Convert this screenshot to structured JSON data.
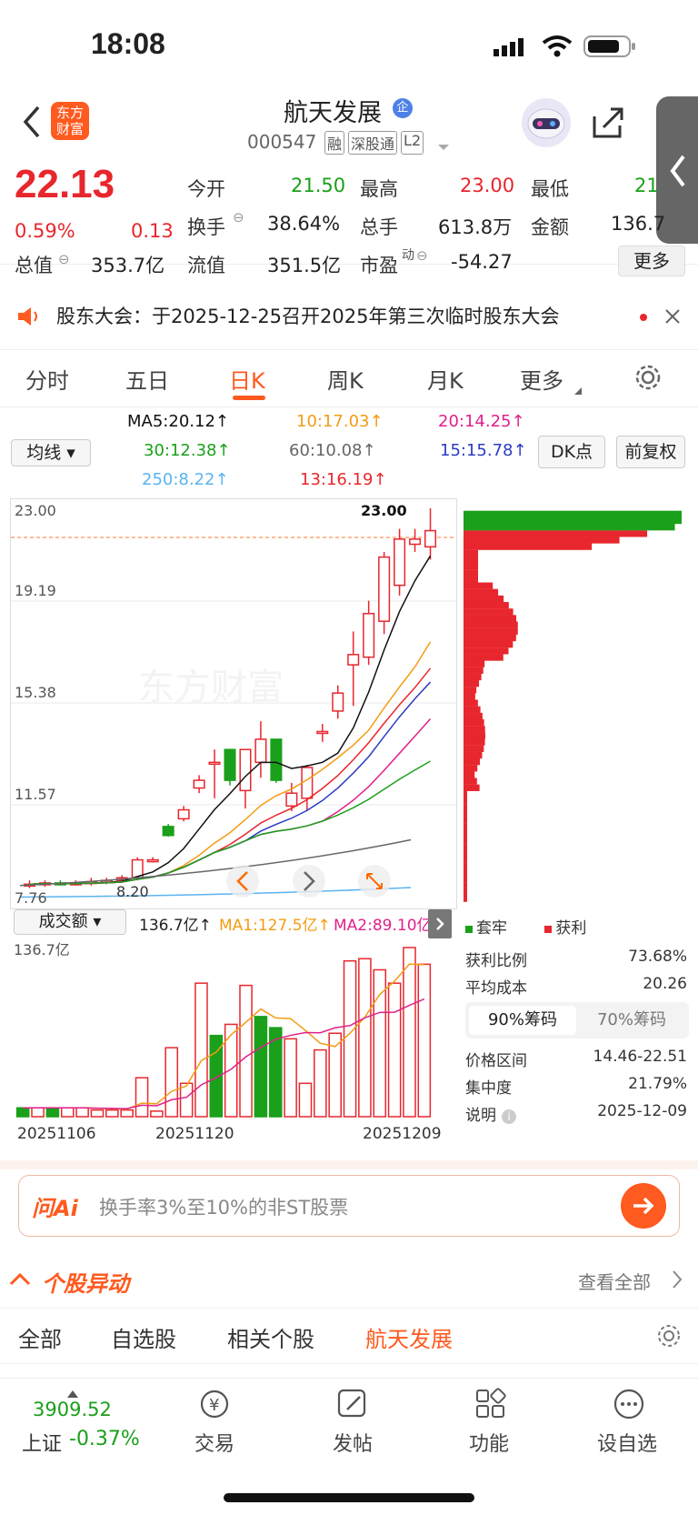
{
  "status": {
    "time": "18:08"
  },
  "header": {
    "logo_text": "东方财富",
    "stock_name": "航天发展",
    "stock_code": "000547",
    "tags": [
      "融",
      "深股通",
      "L2"
    ]
  },
  "quote": {
    "price": "22.13",
    "change_pct": "0.59%",
    "change": "0.13",
    "total_value_label": "总值",
    "total_value": "353.7亿",
    "float_value_label": "流值",
    "float_value": "351.5亿",
    "open_label": "今开",
    "open": "21.50",
    "high_label": "最高",
    "high": "23.00",
    "low_label": "最低",
    "low": "21",
    "turnover_label": "换手",
    "turnover": "38.64%",
    "volume_label": "总手",
    "volume": "613.8万",
    "amount_label": "金额",
    "amount": "136.7",
    "pe_label": "市盈",
    "pe_sup": "动",
    "pe": "-54.27",
    "more_button": "更多"
  },
  "notice": {
    "text": "股东大会：于2025-12-25召开2025年第三次临时股东大会"
  },
  "tabs": [
    {
      "label": "分时"
    },
    {
      "label": "五日"
    },
    {
      "label": "日K"
    },
    {
      "label": "周K"
    },
    {
      "label": "月K"
    },
    {
      "label": "更多"
    }
  ],
  "ma": {
    "selector": "均线",
    "ma5": "MA5:20.12↑",
    "ma10": "10:17.03↑",
    "ma20": "20:14.25↑",
    "ma30": "30:12.38↑",
    "ma60": "60:10.08↑",
    "ma15": "15:15.78↑",
    "ma250": "250:8.22↑",
    "ma13": "13:16.19↑",
    "dk_button": "DK点",
    "adjust_button": "前复权"
  },
  "chart_data": {
    "type": "candlestick",
    "y_ticks": [
      "23.00",
      "19.19",
      "15.38",
      "11.57",
      "7.76"
    ],
    "high_marker": "23.00",
    "low_marker": "8.20",
    "volume_panel": {
      "selector": "成交额",
      "current": "136.7亿↑",
      "ma1": "MA1:127.5亿↑",
      "ma2": "MA2:89.10亿",
      "max_label": "136.7亿",
      "x_labels": [
        "20251106",
        "20251120",
        "20251209"
      ],
      "volume_values": [
        8,
        8,
        8,
        8,
        8,
        6,
        6,
        6,
        35,
        5,
        62,
        30,
        120,
        73,
        83,
        118,
        90,
        80,
        70,
        30,
        60,
        75,
        140,
        142,
        132,
        120,
        152,
        137
      ],
      "volume_up": [
        false,
        true,
        false,
        true,
        true,
        true,
        true,
        true,
        true,
        true,
        true,
        true,
        true,
        false,
        true,
        true,
        false,
        false,
        true,
        true,
        true,
        true,
        true,
        true,
        true,
        true,
        true,
        true
      ]
    },
    "candles": [
      {
        "o": 8.3,
        "c": 8.35,
        "h": 8.5,
        "l": 8.2
      },
      {
        "o": 8.35,
        "c": 8.4,
        "h": 8.5,
        "l": 8.25
      },
      {
        "o": 8.4,
        "c": 8.35,
        "h": 8.5,
        "l": 8.3
      },
      {
        "o": 8.35,
        "c": 8.4,
        "h": 8.5,
        "l": 8.3
      },
      {
        "o": 8.4,
        "c": 8.45,
        "h": 8.6,
        "l": 8.3
      },
      {
        "o": 8.45,
        "c": 8.5,
        "h": 8.6,
        "l": 8.35
      },
      {
        "o": 8.5,
        "c": 8.6,
        "h": 8.7,
        "l": 8.4
      },
      {
        "o": 8.6,
        "c": 9.3,
        "h": 9.4,
        "l": 8.5
      },
      {
        "o": 9.3,
        "c": 9.3,
        "h": 9.4,
        "l": 9.2
      },
      {
        "o": 10.6,
        "c": 10.25,
        "h": 10.7,
        "l": 10.2
      },
      {
        "o": 10.9,
        "c": 11.25,
        "h": 11.4,
        "l": 10.8
      },
      {
        "o": 12.1,
        "c": 12.4,
        "h": 12.6,
        "l": 11.9
      },
      {
        "o": 13.1,
        "c": 13.1,
        "h": 13.6,
        "l": 11.7
      },
      {
        "o": 13.6,
        "c": 12.4,
        "h": 13.6,
        "l": 12.2
      },
      {
        "o": 12.0,
        "c": 13.6,
        "h": 13.6,
        "l": 11.3
      },
      {
        "o": 13.1,
        "c": 14.0,
        "h": 14.7,
        "l": 12.5
      },
      {
        "o": 14.0,
        "c": 12.4,
        "h": 14.0,
        "l": 12.3
      },
      {
        "o": 11.4,
        "c": 11.9,
        "h": 12.3,
        "l": 11.2
      },
      {
        "o": 11.7,
        "c": 12.9,
        "h": 13.0,
        "l": 11.2
      },
      {
        "o": 14.3,
        "c": 14.3,
        "h": 14.6,
        "l": 13.9
      },
      {
        "o": 15.1,
        "c": 15.8,
        "h": 16.1,
        "l": 14.8
      },
      {
        "o": 16.9,
        "c": 17.3,
        "h": 18.2,
        "l": 15.3
      },
      {
        "o": 17.2,
        "c": 18.9,
        "h": 19.4,
        "l": 16.9
      },
      {
        "o": 18.6,
        "c": 21.1,
        "h": 21.3,
        "l": 18.1
      },
      {
        "o": 20.0,
        "c": 21.8,
        "h": 22.2,
        "l": 19.6
      },
      {
        "o": 21.6,
        "c": 21.8,
        "h": 22.2,
        "l": 21.3
      },
      {
        "o": 21.5,
        "c": 22.13,
        "h": 23.0,
        "l": 21.0
      }
    ],
    "ylim": [
      7.76,
      23.0
    ]
  },
  "distribution": {
    "legend_trapped": "套牢",
    "legend_profit": "获利",
    "profit_ratio_label": "获利比例",
    "profit_ratio": "73.68%",
    "avg_cost_label": "平均成本",
    "avg_cost": "20.26",
    "tab_90": "90%筹码",
    "tab_70": "70%筹码",
    "price_range_label": "价格区间",
    "price_range": "14.46-22.51",
    "concentration_label": "集中度",
    "concentration": "21.79%",
    "note_label": "说明",
    "note_date": "2025-12-09"
  },
  "ai": {
    "brand": "问Ai",
    "placeholder": "换手率3%至10%的非ST股票"
  },
  "movement": {
    "title": "个股异动",
    "view_all": "查看全部",
    "tabs": [
      "全部",
      "自选股",
      "相关个股",
      "航天发展"
    ]
  },
  "bottom_nav": {
    "index_value": "3909.52",
    "index_name": "上证",
    "index_change": "-0.37%",
    "items": [
      "交易",
      "发帖",
      "功能",
      "设自选"
    ]
  },
  "colors": {
    "up": "#e8262d",
    "down": "#1aa01a",
    "accent": "#ff6a00"
  }
}
